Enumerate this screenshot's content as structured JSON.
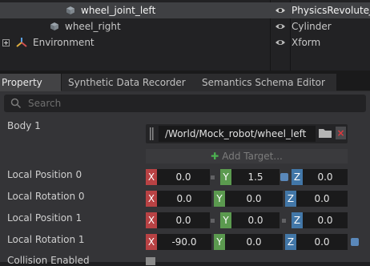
{
  "stage_tree": {
    "rows": [
      {
        "name": "wheel_joint_left",
        "type": "PhysicsRevoluteJoint",
        "selected": true,
        "icon": "cube-icon"
      },
      {
        "name": "wheel_right",
        "type": "Cylinder",
        "selected": false,
        "icon": "cube-icon"
      },
      {
        "name": "Environment",
        "type": "Xform",
        "selected": false,
        "icon": "xform-icon"
      }
    ]
  },
  "tabs": [
    {
      "label": "Property",
      "active": true
    },
    {
      "label": "Synthetic Data Recorder",
      "active": false
    },
    {
      "label": "Semantics Schema Editor",
      "active": false
    }
  ],
  "search": {
    "placeholder": "Search"
  },
  "properties": {
    "body1": {
      "label": "Body 1",
      "path": "/World/Mock_robot/wheel_left",
      "clear": "×",
      "add_target": "Add Target..."
    },
    "local_position_0": {
      "label": "Local Position 0",
      "x": "0.0",
      "y": "1.5",
      "z": "0.0"
    },
    "local_rotation_0": {
      "label": "Local Rotation 0",
      "x": "0.0",
      "y": "0.0",
      "z": "0.0"
    },
    "local_position_1": {
      "label": "Local Position 1",
      "x": "0.0",
      "y": "0.0",
      "z": "0.0"
    },
    "local_rotation_1": {
      "label": "Local Rotation 1",
      "x": "-90.0",
      "y": "0.0",
      "z": "0.0"
    },
    "collision_enabled": {
      "label": "Collision Enabled"
    }
  },
  "axes": {
    "x": "X",
    "y": "Y",
    "z": "Z"
  },
  "colors": {
    "x_axis": "#b84244",
    "y_axis": "#5b9a4f",
    "z_axis": "#4277a8",
    "add_icon": "#4caf50",
    "clear_icon": "#e0383e"
  }
}
